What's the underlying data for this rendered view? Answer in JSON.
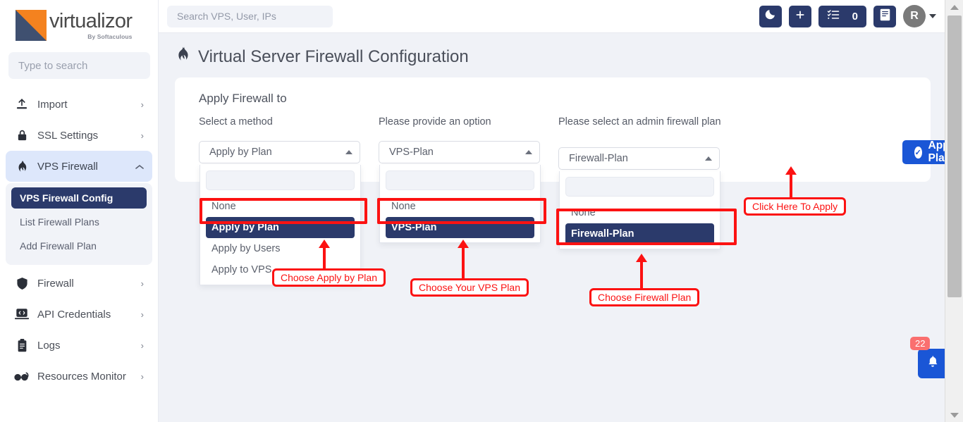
{
  "brand": {
    "name": "virtualizor",
    "tagline": "By Softaculous",
    "logo_orange": "#f4821f",
    "logo_navy": "#3f5070"
  },
  "sidebar": {
    "search_placeholder": "Type to search",
    "items": [
      {
        "label": "Import",
        "icon": "upload-icon",
        "chevron": "›",
        "active": false
      },
      {
        "label": "SSL Settings",
        "icon": "lock-icon",
        "chevron": "›",
        "active": false
      },
      {
        "label": "VPS Firewall",
        "icon": "flame-icon",
        "chevron": "˄",
        "active": true
      },
      {
        "label": "Firewall",
        "icon": "shield-icon",
        "chevron": "›",
        "active": false
      },
      {
        "label": "API Credentials",
        "icon": "laptop-code-icon",
        "chevron": "›",
        "active": false
      },
      {
        "label": "Logs",
        "icon": "clipboard-icon",
        "chevron": "›",
        "active": false
      },
      {
        "label": "Resources Monitor",
        "icon": "glasses-icon",
        "chevron": "›",
        "active": false
      }
    ],
    "submenu": [
      {
        "label": "VPS Firewall Config",
        "active": true
      },
      {
        "label": "List Firewall Plans",
        "active": false
      },
      {
        "label": "Add Firewall Plan",
        "active": false
      }
    ]
  },
  "topbar": {
    "search_placeholder": "Search VPS, User, IPs",
    "dark_mode_icon": "moon-icon",
    "add_icon": "plus-icon",
    "tasks_icon": "task-list-icon",
    "tasks_count": "0",
    "docs_icon": "book-icon",
    "avatar_initial": "R"
  },
  "page": {
    "title": "Virtual Server Firewall Configuration",
    "title_icon": "flame-icon"
  },
  "card": {
    "title": "Apply Firewall to",
    "fields": [
      {
        "label": "Select a method",
        "value": "Apply by Plan",
        "search_value": "",
        "options": [
          "None",
          "Apply by Plan",
          "Apply by Users",
          "Apply to VPS"
        ],
        "selected": "Apply by Plan"
      },
      {
        "label": "Please provide an option",
        "value": "VPS-Plan",
        "search_value": "",
        "options": [
          "None",
          "VPS-Plan"
        ],
        "selected": "VPS-Plan"
      },
      {
        "label": "Please select an admin firewall plan",
        "value": "Firewall-Plan",
        "search_value": "",
        "options": [
          "None",
          "Firewall-Plan"
        ],
        "selected": "Firewall-Plan"
      }
    ],
    "apply_button": {
      "label": "Apply Plan",
      "icon": "check-circle-icon",
      "color": "#1a56d6"
    }
  },
  "annotations": {
    "color": "#fc1212",
    "callouts": [
      "Choose Apply by Plan",
      "Choose Your VPS Plan",
      "Choose Firewall Plan",
      "Click Here To Apply"
    ]
  },
  "notification": {
    "count": "22",
    "icon": "bell-icon",
    "badge_color": "#fa6f6f",
    "button_color": "#1a56d6"
  }
}
